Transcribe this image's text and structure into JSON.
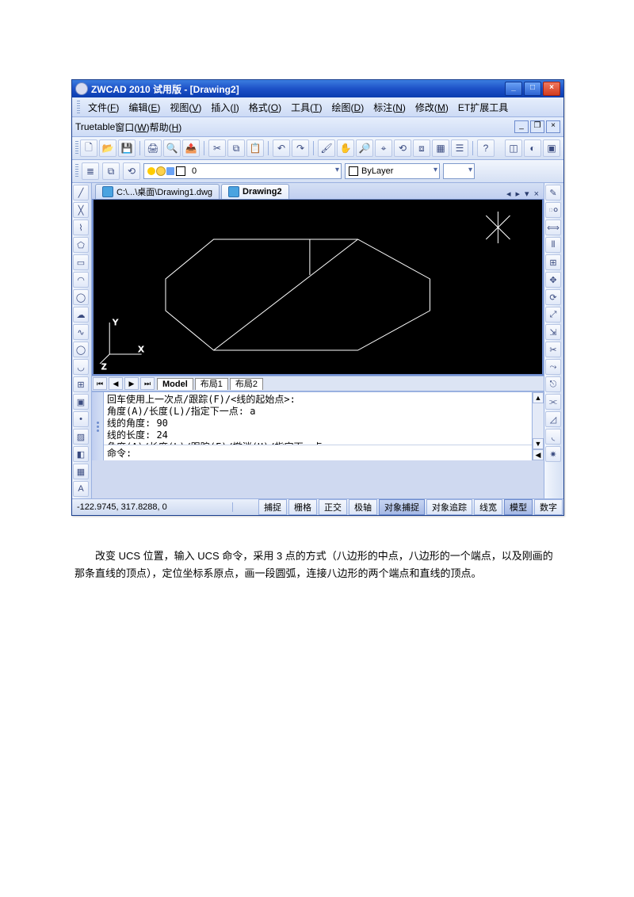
{
  "titlebar": {
    "title": "ZWCAD 2010 试用版 - [Drawing2]"
  },
  "menubar": {
    "items": [
      {
        "label": "文件",
        "key": "F"
      },
      {
        "label": "编辑",
        "key": "E"
      },
      {
        "label": "视图",
        "key": "V"
      },
      {
        "label": "插入",
        "key": "I"
      },
      {
        "label": "格式",
        "key": "O"
      },
      {
        "label": "工具",
        "key": "T"
      },
      {
        "label": "绘图",
        "key": "D"
      },
      {
        "label": "标注",
        "key": "N"
      },
      {
        "label": "修改",
        "key": "M"
      },
      {
        "label": "ET扩展工具",
        "key": ""
      }
    ],
    "row2": [
      {
        "label": "Truetable",
        "key": ""
      },
      {
        "label": "窗口",
        "key": "W"
      },
      {
        "label": "帮助",
        "key": "H"
      }
    ]
  },
  "layer_bar": {
    "current_layer": "0",
    "bylayer_label": "ByLayer"
  },
  "doc_tabs": {
    "tab1": "C:\\...\\桌面\\Drawing1.dwg",
    "tab2": "Drawing2"
  },
  "layout_tabs": {
    "model": "Model",
    "layout1": "布局1",
    "layout2": "布局2"
  },
  "cmd": {
    "line1": "回车使用上一次点/跟踪(F)/<线的起始点>:",
    "line2": "角度(A)/长度(L)/指定下一点: a",
    "line3": "线的角度: 90",
    "line4": "线的长度: 24",
    "line5": "角度(A)/长度(L)/跟踪(F)/撤消(U)/指定下一点:",
    "prompt": "命令:"
  },
  "status": {
    "coords": "-122.9745,  317.8288,  0",
    "snap": "捕捉",
    "grid": "栅格",
    "ortho": "正交",
    "polar": "极轴",
    "osnap": "对象捕捉",
    "otrack": "对象追踪",
    "lwt": "线宽",
    "model": "模型",
    "digit": "数字"
  },
  "description": {
    "p1": "改变 UCS 位置，输入 UCS 命令，采用 3 点的方式（八边形的中点，八边形的一个端点，以及刚画的那条直线的顶点），定位坐标系原点，画一段圆弧，连接八边形的两个端点和直线的顶点。"
  }
}
